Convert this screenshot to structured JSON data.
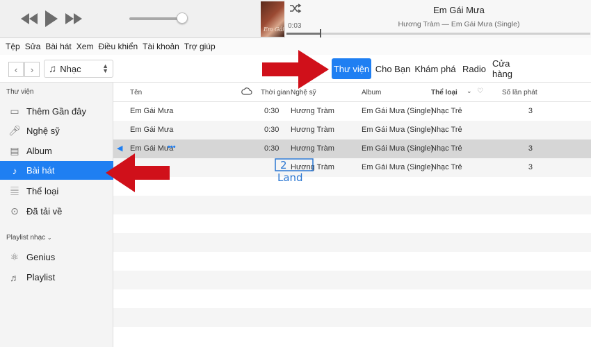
{
  "player": {
    "elapsed": "0:03",
    "now_playing_title": "Em Gái Mưa",
    "now_playing_subtitle": "Hương Tràm — Em Gái Mưa (Single)",
    "progress_fraction": 0.11,
    "volume_fraction": 0.9,
    "album_art_text": "Em Gái"
  },
  "menu": [
    "Tệp",
    "Sửa",
    "Bài hát",
    "Xem",
    "Điều khiển",
    "Tài khoản",
    "Trợ giúp"
  ],
  "toolbar": {
    "back": "‹",
    "forward": "›",
    "media_select": "Nhạc",
    "tabs": [
      "Thư viện",
      "Cho Bạn",
      "Khám phá",
      "Radio",
      "Cửa hàng"
    ],
    "active_tab": "Thư viện"
  },
  "sidebar": {
    "library_heading": "Thư viện",
    "library_items": [
      {
        "label": "Thêm Gần đây",
        "icon": "recently-added-icon"
      },
      {
        "label": "Nghệ sỹ",
        "icon": "artists-icon"
      },
      {
        "label": "Album",
        "icon": "albums-icon"
      },
      {
        "label": "Bài hát",
        "icon": "songs-icon"
      },
      {
        "label": "Thể loại",
        "icon": "genres-icon"
      },
      {
        "label": "Đã tải về",
        "icon": "downloaded-icon"
      }
    ],
    "active_item": "Bài hát",
    "playlist_heading": "Playlist nhạc",
    "playlist_items": [
      {
        "label": "Genius",
        "icon": "genius-icon"
      },
      {
        "label": "Playlist",
        "icon": "playlist-icon"
      }
    ]
  },
  "table": {
    "columns": {
      "name": "Tên",
      "time": "Thời gian",
      "artist": "Nghệ sỹ",
      "album": "Album",
      "genre": "Thể loại",
      "plays": "Số lần phát"
    },
    "rows": [
      {
        "name": "Em Gái Mưa",
        "time": "0:30",
        "artist": "Hương Tràm",
        "album": "Em Gái Mưa (Single)",
        "genre": "Nhạc Trẻ",
        "plays": "3"
      },
      {
        "name": "Em Gái Mưa",
        "time": "0:30",
        "artist": "Hương Tràm",
        "album": "Em Gái Mưa (Single)",
        "genre": "Nhạc Trẻ",
        "plays": ""
      },
      {
        "name": "Em Gái Mưa",
        "time": "0:30",
        "artist": "Hương Tràm",
        "album": "Em Gái Mưa (Single)",
        "genre": "Nhạc Trẻ",
        "plays": "3"
      },
      {
        "name": "",
        "time": "",
        "artist": "Hương Tràm",
        "album": "Em Gái Mưa (Single)",
        "genre": "Nhạc Trẻ",
        "plays": "3"
      }
    ],
    "playing_row_index": 2,
    "more_indicator": "•••"
  },
  "watermark": {
    "top": "2",
    "bottom": "Land"
  },
  "colors": {
    "accent": "#1f7ff2",
    "annotation_arrow": "#d0101a"
  }
}
